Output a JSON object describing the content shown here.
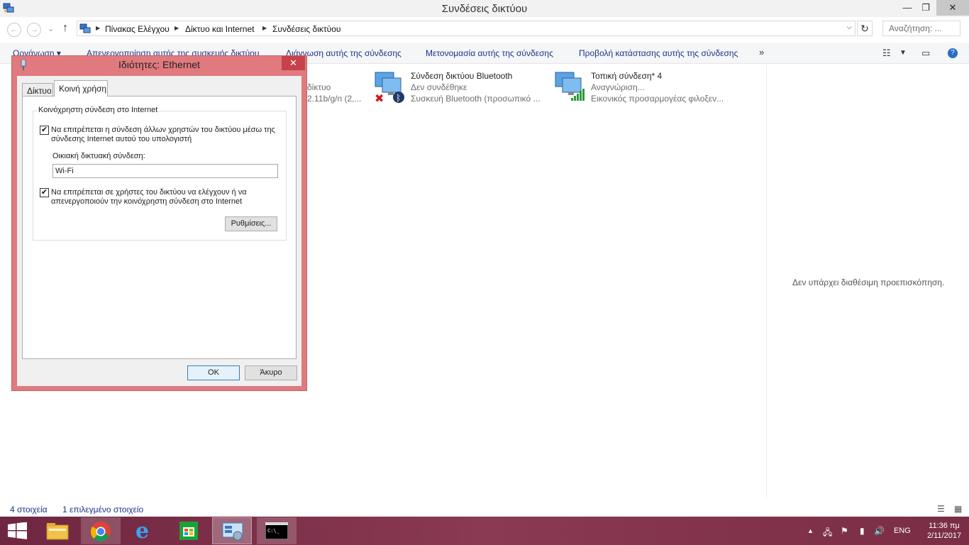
{
  "window": {
    "title": "Συνδέσεις δικτύου",
    "minimize": "—",
    "maximize": "❐",
    "close": "✕"
  },
  "address": {
    "back": "←",
    "forward": "→",
    "history": "⌄",
    "up": "↑",
    "breadcrumbs": [
      "Πίνακας Ελέγχου",
      "Δίκτυο και Internet",
      "Συνδέσεις δικτύου"
    ],
    "search_placeholder": "Αναζήτηση: ..."
  },
  "commands": {
    "organize": "Οργάνωση ▾",
    "disable": "Απενεργοποίηση αυτής της συσκευής δικτύου",
    "diagnose": "Διάγνωση αυτής της σύνδεσης",
    "rename": "Μετονομασία αυτής της σύνδεσης",
    "view_status": "Προβολή κατάστασης αυτής της σύνδεσης",
    "more": "»"
  },
  "connections": {
    "partial_line2": "δίκτυο",
    "partial_line3": "2.11b/g/n (2,...",
    "bluetooth": {
      "name": "Σύνδεση δικτύου Bluetooth",
      "status": "Δεν συνδέθηκε",
      "device": "Συσκευή Bluetooth (προσωπικό ..."
    },
    "local4": {
      "name": "Τοπική σύνδεση* 4",
      "status": "Αναγνώριση...",
      "device": "Εικονικός προσαρμογέας φιλοξεν..."
    }
  },
  "preview": {
    "empty_text": "Δεν υπάρχει διαθέσιμη προεπισκόπηση."
  },
  "statusbar": {
    "count": "4 στοιχεία",
    "selected": "1 επιλεγμένο στοιχείο"
  },
  "dialog": {
    "title": "Ιδιότητες: Ethernet",
    "close": "✕",
    "tabs": [
      "Δίκτυο",
      "Κοινή χρήση"
    ],
    "group_label": "Κοινόχρηστη σύνδεση στο Internet",
    "allow_share_label": "Να επιτρέπεται η σύνδεση άλλων χρηστών του δικτύου μέσω της σύνδεσης Internet αυτού του υπολογιστή",
    "allow_share_checked": true,
    "home_conn_label": "Οικιακή δικτυακή σύνδεση:",
    "home_conn_value": "Wi-Fi",
    "allow_control_label": "Να επιτρέπεται σε χρήστες του δικτύου να ελέγχουν ή να απενεργοποιούν την κοινόχρηστη σύνδεση στο Internet",
    "allow_control_checked": true,
    "settings_button": "Ρυθμίσεις...",
    "ok_button": "OK",
    "cancel_button": "Άκυρο"
  },
  "taskbar": {
    "language": "ENG",
    "time": "11:36 πμ",
    "date": "2/11/2017"
  },
  "colors": {
    "dialog_frame": "#e07a7e",
    "taskbar": "#7b2e46",
    "link_blue": "#1e3287"
  }
}
